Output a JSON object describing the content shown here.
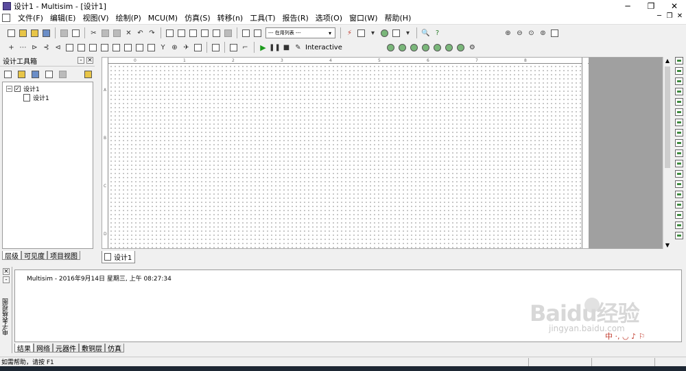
{
  "window": {
    "title": "设计1 - Multisim - [设计1]",
    "controls": [
      "─",
      "❐",
      "✕"
    ]
  },
  "menu": [
    "文件(F)",
    "编辑(E)",
    "视图(V)",
    "绘制(P)",
    "MCU(M)",
    "仿真(S)",
    "转移(n)",
    "工具(T)",
    "报告(R)",
    "选项(O)",
    "窗口(W)",
    "帮助(H)"
  ],
  "mdi_controls": [
    "─",
    "❐",
    "✕"
  ],
  "toolbar": {
    "usage_list_placeholder": "--- 在用列表 ---",
    "interactive_label": "Interactive"
  },
  "design_toolbox": {
    "title": "设计工具箱",
    "tree": {
      "root": "设计1",
      "child": "设计1"
    },
    "tabs": [
      "层级",
      "可见度",
      "项目视图"
    ]
  },
  "workspace": {
    "tab_label": "设计1",
    "ruler_cols": [
      "0",
      "1",
      "2",
      "3",
      "4",
      "5",
      "6",
      "7",
      "8"
    ],
    "ruler_rows": [
      "A",
      "B",
      "C",
      "D"
    ]
  },
  "spreadsheet": {
    "side_label": "电子表格视图",
    "log_line": "Multisim  -  2016年9月14日 星期三, 上午 08:27:34",
    "tabs": [
      "结果",
      "网络",
      "元器件",
      "敷铜层",
      "仿真"
    ]
  },
  "status": {
    "help_text": "如需帮助，请按 F1"
  },
  "watermark": {
    "brand": "Baidu经验",
    "sub": "jingyan.baidu.com"
  },
  "tray": {
    "icons_text": "中 ·, ◡ ♪ ⚐"
  }
}
